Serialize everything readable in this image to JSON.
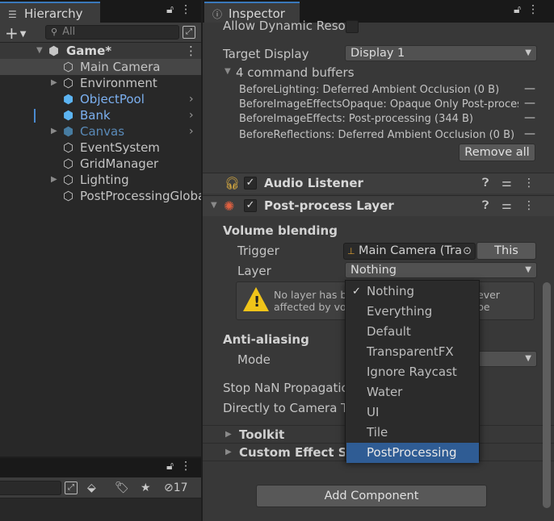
{
  "hierarchy": {
    "tab_label": "Hierarchy",
    "tab_icon": "list-icon",
    "search_placeholder": "All",
    "scene_name": "Game*",
    "items": [
      {
        "label": "Main Camera",
        "expandable": false,
        "prefab": false,
        "selected": true
      },
      {
        "label": "Environment",
        "expandable": true,
        "prefab": false
      },
      {
        "label": "ObjectPool",
        "expandable": false,
        "prefab": true
      },
      {
        "label": "Bank",
        "expandable": false,
        "prefab": true
      },
      {
        "label": "Canvas",
        "expandable": true,
        "prefab": true,
        "inactive": true
      },
      {
        "label": "EventSystem",
        "expandable": false,
        "prefab": false
      },
      {
        "label": "GridManager",
        "expandable": false,
        "prefab": false
      },
      {
        "label": "Lighting",
        "expandable": true,
        "prefab": false
      },
      {
        "label": "PostProcessingGloba",
        "expandable": false,
        "prefab": false
      }
    ]
  },
  "project": {
    "hidden_count": "17"
  },
  "inspector": {
    "tab_label": "Inspector",
    "tab_icon": "info-icon",
    "allow_dynamic_label": "Allow Dynamic Reso",
    "target_display_label": "Target Display",
    "target_display_value": "Display 1",
    "command_buffers_label": "4 command buffers",
    "command_buffers": [
      "BeforeLighting: Deferred Ambient Occlusion (0 B)",
      "BeforeImageEffectsOpaque: Opaque Only Post-process",
      "BeforeImageEffects: Post-processing (344 B)",
      "BeforeReflections: Deferred Ambient Occlusion (0 B)"
    ],
    "remove_all_label": "Remove all",
    "audio_listener": {
      "title": "Audio Listener",
      "enabled": true
    },
    "post_process_layer": {
      "title": "Post-process Layer",
      "enabled": true,
      "volume_blending_label": "Volume blending",
      "trigger_label": "Trigger",
      "trigger_value": "Main Camera (Tra",
      "this_button": "This",
      "layer_label": "Layer",
      "layer_value": "Nothing",
      "warning_line1": "No layer has b",
      "warning_line1_end": "ever be",
      "warning_line2": "affected by vo",
      "anti_aliasing_label": "Anti-aliasing",
      "mode_label": "Mode",
      "stop_nan_label": "Stop NaN Propagatic",
      "directly_label": "Directly to Camera T"
    },
    "toolkit_label": "Toolkit",
    "custom_effect_label": "Custom Effect So",
    "add_component_label": "Add Component"
  },
  "layer_menu": {
    "items": [
      "Nothing",
      "Everything",
      "Default",
      "TransparentFX",
      "Ignore Raycast",
      "Water",
      "UI",
      "Tile",
      "PostProcessing"
    ],
    "checked_index": 0,
    "highlighted_index": 8
  },
  "colors": {
    "accent_blue": "#2f5c94",
    "prefab_blue": "#7cb0f0",
    "warning_yellow": "#f0c419",
    "panel_bg": "#383838"
  }
}
